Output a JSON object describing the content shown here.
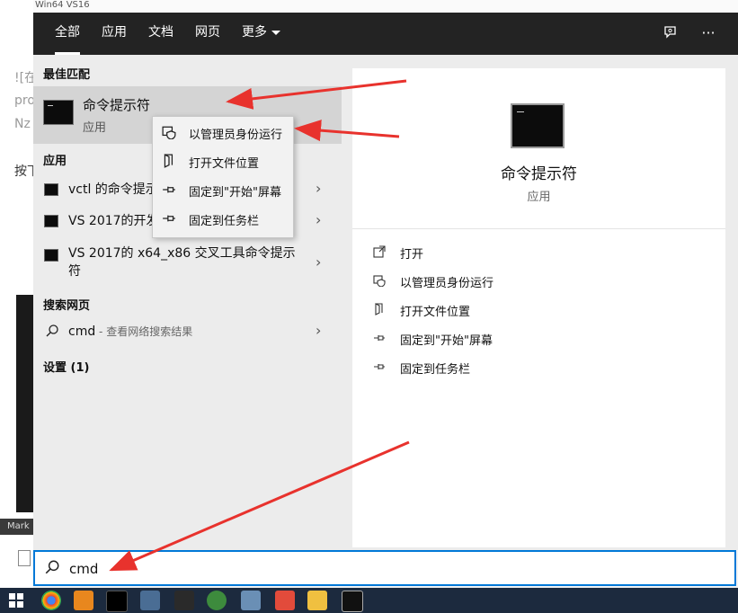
{
  "background": {
    "left_texts": [
      "![在",
      "pro",
      "Nz",
      "按下"
    ],
    "side_label": "Mark",
    "top_text": "Win64 VS16"
  },
  "tabs": [
    {
      "label": "全部",
      "active": true
    },
    {
      "label": "应用",
      "active": false
    },
    {
      "label": "文档",
      "active": false
    },
    {
      "label": "网页",
      "active": false
    },
    {
      "label": "更多",
      "active": false
    }
  ],
  "top_icons": {
    "feedback": "feedback-icon",
    "more": "···"
  },
  "best_match": {
    "heading": "最佳匹配",
    "title": "命令提示符",
    "subtitle": "应用"
  },
  "apps": {
    "heading": "应用",
    "items": [
      {
        "label": "vctl 的命令提示符"
      },
      {
        "label": "VS 2017的开发人员命令提示符"
      },
      {
        "label": "VS 2017的 x64_x86 交叉工具命令提示符"
      }
    ]
  },
  "web": {
    "heading": "搜索网页",
    "query": "cmd",
    "hint": " - 查看网络搜索结果"
  },
  "settings": {
    "heading": "设置 (1)"
  },
  "context_menu": [
    {
      "label": "以管理员身份运行",
      "icon": "shield-icon"
    },
    {
      "label": "打开文件位置",
      "icon": "file-location-icon"
    },
    {
      "label": "固定到\"开始\"屏幕",
      "icon": "pin-icon"
    },
    {
      "label": "固定到任务栏",
      "icon": "pin-icon"
    }
  ],
  "detail": {
    "title": "命令提示符",
    "subtitle": "应用",
    "actions": [
      {
        "label": "打开",
        "icon": "open-icon"
      },
      {
        "label": "以管理员身份运行",
        "icon": "shield-icon"
      },
      {
        "label": "打开文件位置",
        "icon": "file-location-icon"
      },
      {
        "label": "固定到\"开始\"屏幕",
        "icon": "pin-icon"
      },
      {
        "label": "固定到任务栏",
        "icon": "pin-icon"
      }
    ]
  },
  "search": {
    "value": "cmd"
  },
  "colors": {
    "accent": "#0078d7",
    "arrow": "#e8322d",
    "topbar": "#232323",
    "taskbar": "#1c2a3e"
  }
}
